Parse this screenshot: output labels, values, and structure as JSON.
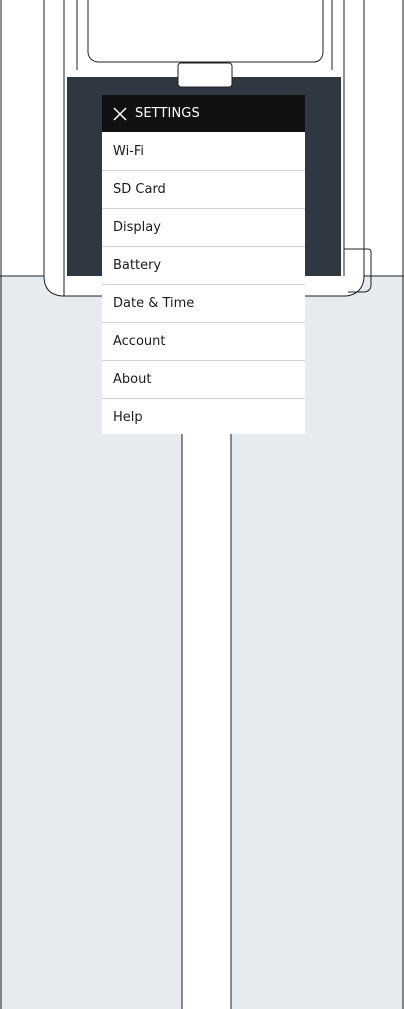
{
  "settings_menu": {
    "title": "SETTINGS",
    "close_icon": "close-icon",
    "items": [
      {
        "label": "Wi-Fi"
      },
      {
        "label": "SD Card"
      },
      {
        "label": "Display"
      },
      {
        "label": "Battery"
      },
      {
        "label": "Date & Time"
      },
      {
        "label": "Account"
      },
      {
        "label": "About"
      },
      {
        "label": "Help"
      }
    ]
  },
  "colors": {
    "header_background": "#111111",
    "header_text": "#ffffff",
    "menu_background": "#ffffff",
    "divider": "#cfd3d8",
    "screen_frame": "#2f3840",
    "stand_background": "#e6ebef",
    "outline": "#1f1f1f"
  }
}
